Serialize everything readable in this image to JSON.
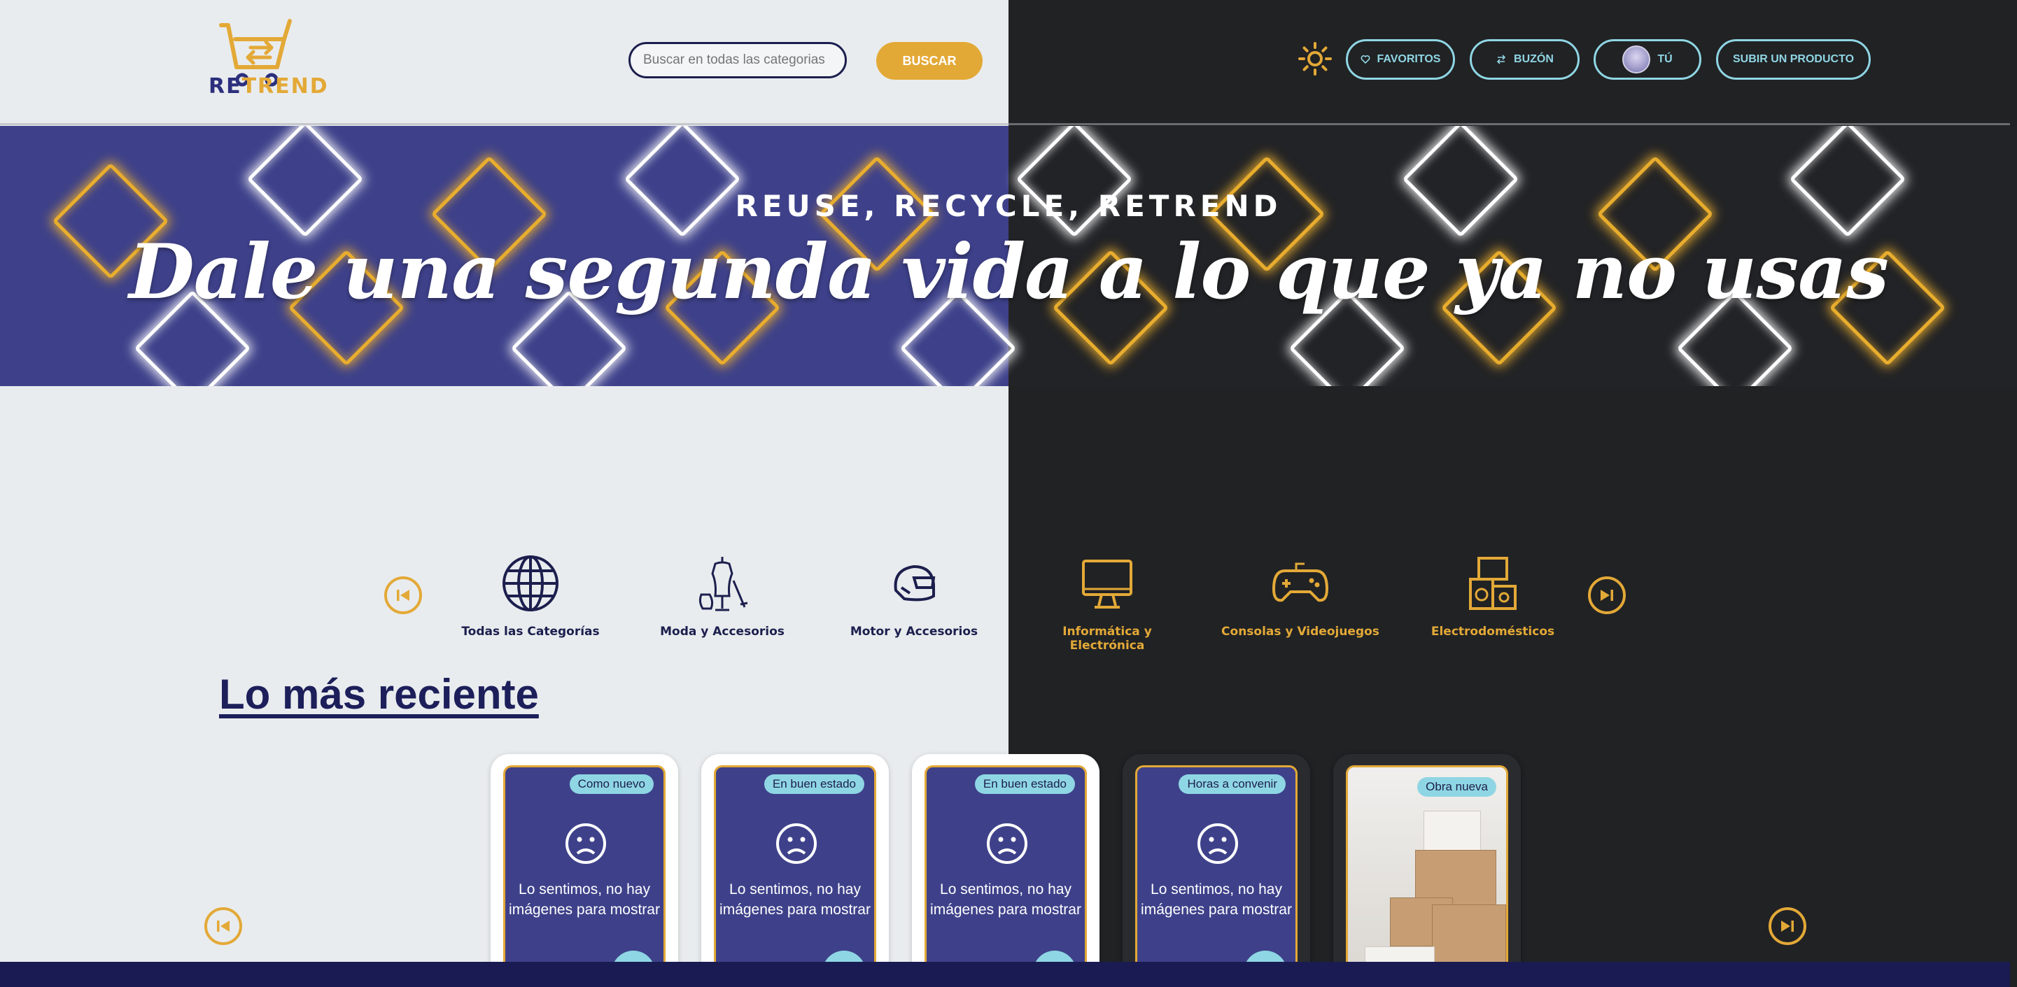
{
  "header": {
    "logo_re": "RE",
    "logo_trend": "TREND",
    "search_placeholder": "Buscar en todas las categorias",
    "search_button": "BUSCAR",
    "theme_icon": "sun-icon",
    "favorites_label": "FAVORITOS",
    "inbox_label": "BUZÓN",
    "profile_label": "TÚ",
    "sell_label": "SUBIR UN PRODUCTO"
  },
  "hero": {
    "subtitle": "REUSE, RECYCLE, RETREND",
    "title": "Dale una segunda vida a lo que ya no usas"
  },
  "categories": [
    {
      "label": "Todas las Categorías",
      "icon": "globe-icon"
    },
    {
      "label": "Moda y Accesorios",
      "icon": "mannequin-icon"
    },
    {
      "label": "Motor y Accesorios",
      "icon": "helmet-icon"
    },
    {
      "label": "Informática y Electrónica",
      "icon": "monitor-icon"
    },
    {
      "label": "Consolas y Videojuegos",
      "icon": "gamepad-icon"
    },
    {
      "label": "Electrodomésticos",
      "icon": "appliances-icon"
    }
  ],
  "recent": {
    "title": "Lo más reciente",
    "cards": [
      {
        "badge": "Como nuevo",
        "text": "Lo sentimos, no hay imágenes para mostrar"
      },
      {
        "badge": "En buen estado",
        "text": "Lo sentimos, no hay imágenes para mostrar"
      },
      {
        "badge": "En buen estado",
        "text": "Lo sentimos, no hay imágenes para mostrar"
      },
      {
        "badge": "Horas a convenir",
        "text": "Lo sentimos, no hay imágenes para mostrar"
      },
      {
        "badge": "Obra nueva",
        "text": ""
      }
    ]
  },
  "colors": {
    "navy": "#1c1f4d",
    "indigo": "#3e418a",
    "gold": "#e3a937",
    "cyan": "#8fd6e4",
    "light_bg": "#e9ecee",
    "dark_bg": "#212224"
  }
}
